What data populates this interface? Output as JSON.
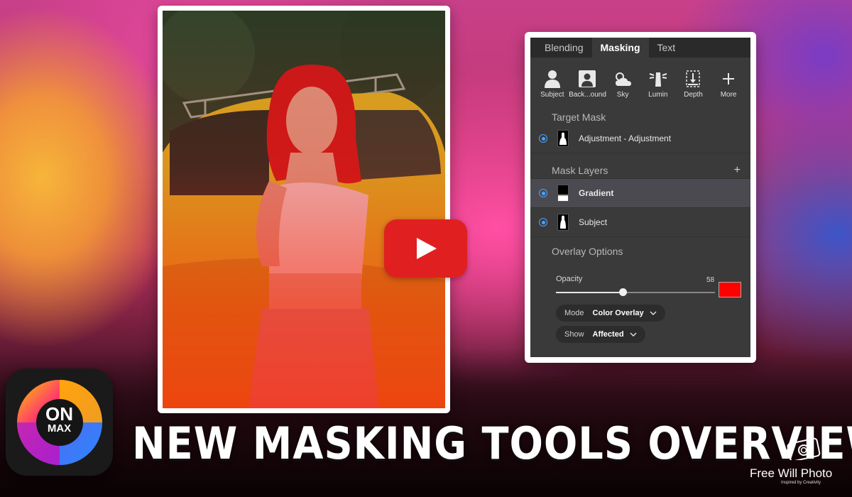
{
  "panel": {
    "tabs": [
      "Blending",
      "Masking",
      "Text"
    ],
    "active_tab": "Masking",
    "tools": [
      {
        "label": "Subject",
        "icon": "person-icon"
      },
      {
        "label": "Back...ound",
        "icon": "portrait-icon"
      },
      {
        "label": "Sky",
        "icon": "cloud-sun-icon"
      },
      {
        "label": "Lumin",
        "icon": "lighthouse-icon"
      },
      {
        "label": "Depth",
        "icon": "depth-icon"
      },
      {
        "label": "More",
        "icon": "plus-icon"
      }
    ],
    "target_mask": {
      "title": "Target Mask",
      "item": "Adjustment - Adjustment"
    },
    "mask_layers": {
      "title": "Mask Layers",
      "add_label": "+",
      "items": [
        "Gradient",
        "Subject"
      ],
      "selected": "Gradient"
    },
    "overlay_options": {
      "title": "Overlay Options",
      "opacity_label": "Opacity",
      "opacity_value": "58",
      "opacity_fraction": 0.42,
      "overlay_color": "#ff0000",
      "mode_label": "Mode",
      "mode_value": "Color Overlay",
      "show_label": "Show",
      "show_value": "Affected"
    }
  },
  "logo": {
    "text_top": "ON",
    "text_bottom": "MAX"
  },
  "headline": "NEW MASKING TOOLS OVERVIEW",
  "watermark": {
    "name": "Free Will Photo",
    "tagline": "Inspired by Creativity"
  }
}
